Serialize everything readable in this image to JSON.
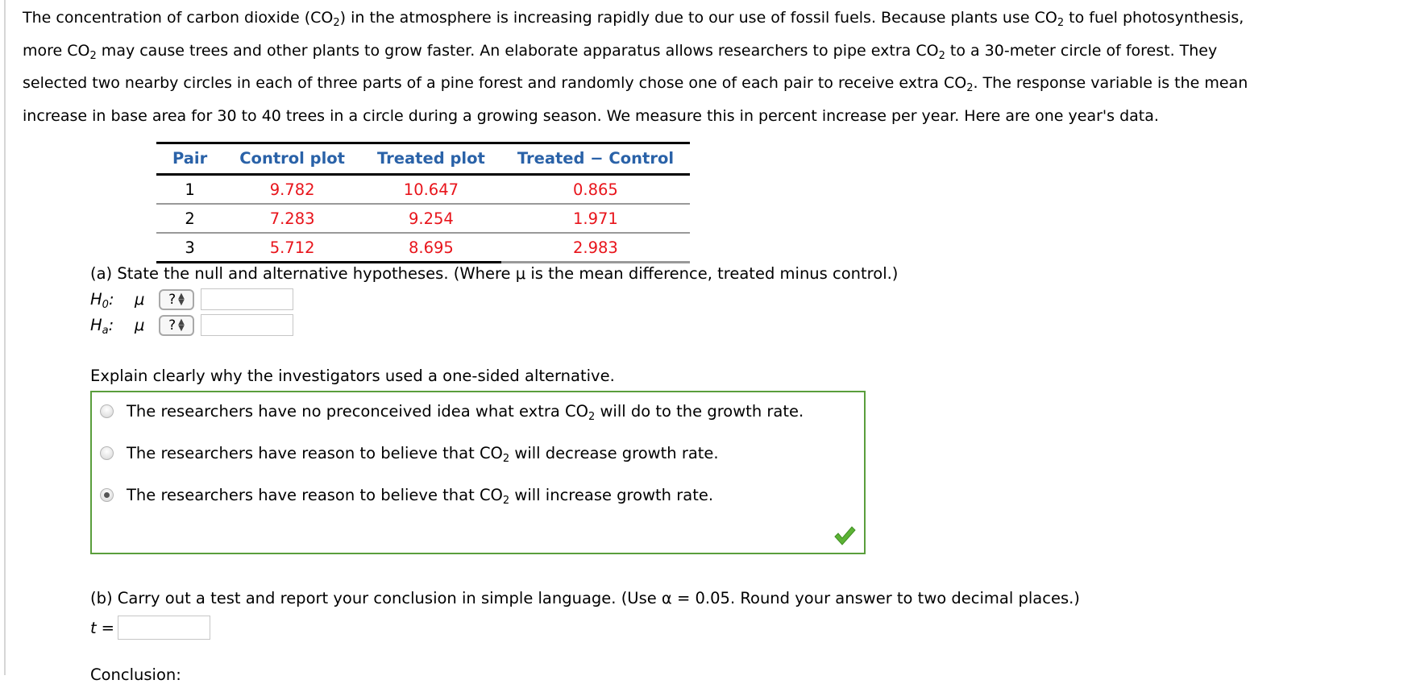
{
  "intro": {
    "line1_a": "The concentration of carbon dioxide (CO",
    "line1_b": ") in the atmosphere is increasing rapidly due to our use of fossil fuels. Because plants use CO",
    "line1_c": " to fuel photosynthesis,",
    "line2_a": "more CO",
    "line2_b": " may cause trees and other plants to grow faster. An elaborate apparatus allows researchers to pipe extra CO",
    "line2_c": " to a 30-meter circle of forest. They",
    "line3_a": "selected two nearby circles in each of three parts of a pine forest and randomly chose one of each pair to receive extra CO",
    "line3_b": ". The response variable is the mean",
    "line4": "increase in base area for 30 to 40 trees in a circle during a growing season. We measure this in percent increase per year. Here are one year's data.",
    "subscript": "2"
  },
  "table": {
    "headers": [
      "Pair",
      "Control plot",
      "Treated plot",
      "Treated − Control"
    ],
    "rows": [
      {
        "pair": "1",
        "control": "9.782",
        "treated": "10.647",
        "diff": "0.865"
      },
      {
        "pair": "2",
        "control": "7.283",
        "treated": "9.254",
        "diff": "1.971"
      },
      {
        "pair": "3",
        "control": "5.712",
        "treated": "8.695",
        "diff": "2.983"
      }
    ]
  },
  "part_a": {
    "prompt": "(a) State the null and alternative hypotheses. (Where μ is the mean difference, treated minus control.)",
    "h0_label": "H",
    "h0_sub": "0",
    "ha_label": "H",
    "ha_sub": "a",
    "colon": ":",
    "mu": "μ",
    "select_value": "?",
    "h0_value": "",
    "ha_value": ""
  },
  "explain": {
    "prompt": "Explain clearly why the investigators used a one-sided alternative.",
    "options": [
      {
        "a": "The researchers have no preconceived idea what extra CO",
        "b": " will do to the growth rate.",
        "selected": false
      },
      {
        "a": "The researchers have reason to believe that CO",
        "b": " will decrease growth rate.",
        "selected": false
      },
      {
        "a": "The researchers have reason to believe that CO",
        "b": " will increase growth rate.",
        "selected": true
      }
    ],
    "status_icon": "checkmark-icon",
    "status_color": "#5cb335",
    "border_color": "#5a9e3c"
  },
  "part_b": {
    "prompt": "(b) Carry out a test and report your conclusion in simple language. (Use α = 0.05. Round your answer to two decimal places.)",
    "t_label": "t",
    "t_eq": "=",
    "t_value": ""
  },
  "conclusion_label": "Conclusion:"
}
